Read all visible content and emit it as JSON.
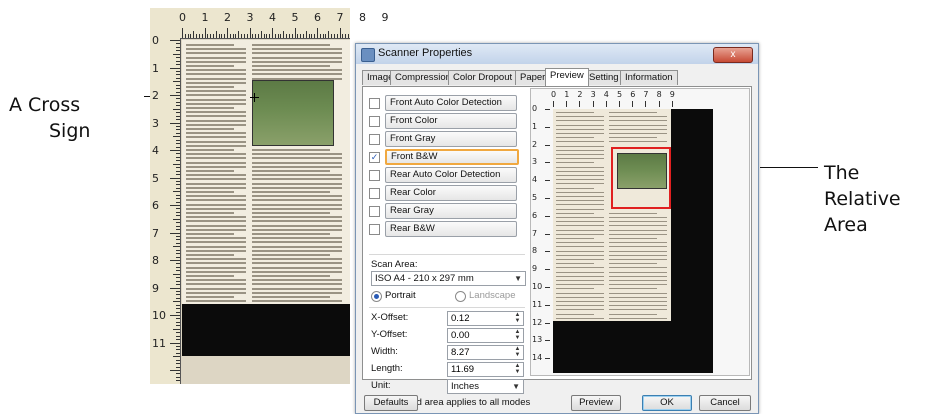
{
  "annotations": {
    "cross_sign_line1": "A Cross",
    "cross_sign_line2": "Sign",
    "relative_area_line1": "The",
    "relative_area_line2": "Relative",
    "relative_area_line3": "Area"
  },
  "background_scan": {
    "ruler_top": [
      "0",
      "1",
      "2",
      "3",
      "4",
      "5",
      "6",
      "7",
      "8",
      "9"
    ],
    "ruler_left": [
      "0",
      "1",
      "2",
      "3",
      "4",
      "5",
      "6",
      "7",
      "8",
      "9",
      "10",
      "11"
    ]
  },
  "dialog": {
    "title": "Scanner Properties",
    "close_label": "x",
    "tabs": [
      "Image",
      "Compression",
      "Color Dropout",
      "Paper",
      "Preview",
      "Setting",
      "Information"
    ],
    "active_tab": "Preview",
    "modes": [
      {
        "label": "Front Auto Color Detection",
        "checked": false
      },
      {
        "label": "Front Color",
        "checked": false
      },
      {
        "label": "Front Gray",
        "checked": false
      },
      {
        "label": "Front B&W",
        "checked": true
      },
      {
        "label": "Rear Auto Color Detection",
        "checked": false
      },
      {
        "label": "Rear Color",
        "checked": false
      },
      {
        "label": "Rear Gray",
        "checked": false
      },
      {
        "label": "Rear B&W",
        "checked": false
      }
    ],
    "scan_area_label": "Scan Area:",
    "scan_area_value": "ISO A4 - 210 x 297 mm",
    "portrait_label": "Portrait",
    "landscape_label": "Landscape",
    "x_offset_label": "X-Offset:",
    "x_offset_value": "0.12",
    "y_offset_label": "Y-Offset:",
    "y_offset_value": "0.00",
    "width_label": "Width:",
    "width_value": "8.27",
    "length_label": "Length:",
    "length_value": "11.69",
    "unit_label": "Unit:",
    "unit_value": "Inches",
    "apply_all_label": "Selected area applies to all modes",
    "preview_ruler_top": [
      "0",
      "1",
      "2",
      "3",
      "4",
      "5",
      "6",
      "7",
      "8",
      "9"
    ],
    "preview_ruler_left": [
      "0",
      "1",
      "2",
      "3",
      "4",
      "5",
      "6",
      "7",
      "8",
      "9",
      "10",
      "11",
      "12",
      "13",
      "14"
    ],
    "buttons": {
      "defaults": "Defaults",
      "preview": "Preview",
      "ok": "OK",
      "cancel": "Cancel"
    }
  },
  "colors": {
    "selection_rect": "#e02020",
    "mode_highlight": "#f0a840",
    "dialog_border": "#7a95b5"
  }
}
